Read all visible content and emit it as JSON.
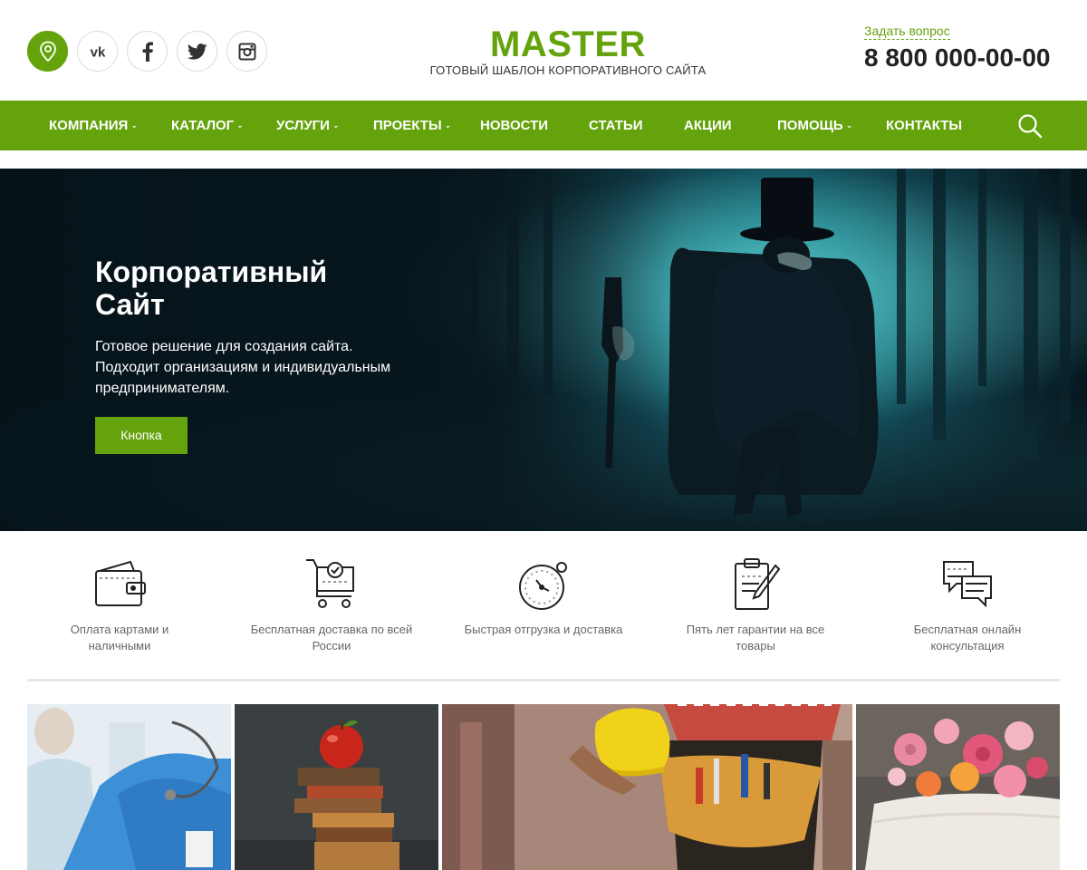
{
  "header": {
    "brand_name": "MASTER",
    "brand_tagline": "ГОТОВЫЙ ШАБЛОН КОРПОРАТИВНОГО САЙТА",
    "ask_question": "Задать вопрос",
    "phone": "8 800 000-00-00",
    "socials": [
      "location-icon",
      "vk-icon",
      "facebook-icon",
      "twitter-icon",
      "instagram-icon"
    ]
  },
  "nav": {
    "items": [
      {
        "label": "КОМПАНИЯ",
        "dropdown": true
      },
      {
        "label": "КАТАЛОГ",
        "dropdown": true
      },
      {
        "label": "УСЛУГИ",
        "dropdown": true
      },
      {
        "label": "ПРОЕКТЫ",
        "dropdown": true
      },
      {
        "label": "НОВОСТИ",
        "dropdown": false
      },
      {
        "label": "СТАТЬИ",
        "dropdown": false
      },
      {
        "label": "АКЦИИ",
        "dropdown": false
      },
      {
        "label": "ПОМОЩЬ",
        "dropdown": true
      },
      {
        "label": "КОНТАКТЫ",
        "dropdown": false
      }
    ],
    "chevron": "⌄",
    "search_icon": "search-icon"
  },
  "hero": {
    "title": "Корпоративный Сайт",
    "text": "Готовое решение для создания сайта. Подходит организациям и индивидуальным предпринимателям.",
    "button": "Кнопка"
  },
  "features": [
    {
      "icon": "wallet-icon",
      "label": "Оплата картами и наличными"
    },
    {
      "icon": "cart-check-icon",
      "label": "Бесплатная доставка по всей России"
    },
    {
      "icon": "stopwatch-icon",
      "label": "Быстрая отгрузка и доставка"
    },
    {
      "icon": "clipboard-pen-icon",
      "label": "Пять лет гарантии на все товары"
    },
    {
      "icon": "chat-bubbles-icon",
      "label": "Бесплатная онлайн консультация"
    }
  ],
  "tiles": [
    "doctor-image",
    "books-apple-image",
    "worker-tools-image",
    "cake-flowers-image"
  ],
  "colors": {
    "accent": "#65a30d",
    "text_dark": "#222222",
    "text_muted": "#666666",
    "divider": "#e3e8ee"
  }
}
